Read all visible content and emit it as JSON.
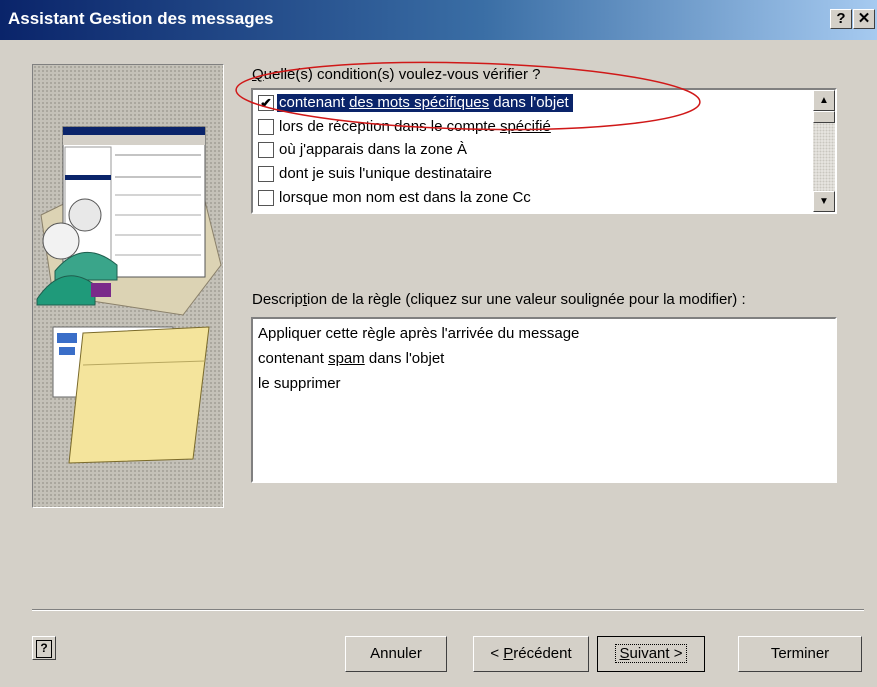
{
  "window": {
    "title": "Assistant Gestion des messages",
    "help_glyph": "?",
    "close_glyph": "✕"
  },
  "conditions": {
    "label_first": "Q",
    "label_rest": "uelle(s) condition(s) voulez-vous vérifier ?",
    "items": [
      {
        "pre": "contenant ",
        "link": "des mots spécifiques",
        "post": " dans l'objet",
        "checked": true,
        "selected": true
      },
      {
        "pre": "lors de réception dans le compte ",
        "link": "spécifié",
        "post": "",
        "checked": false,
        "selected": false
      },
      {
        "pre": "où j'apparais dans la zone À",
        "link": "",
        "post": "",
        "checked": false,
        "selected": false
      },
      {
        "pre": "dont je suis l'unique destinataire",
        "link": "",
        "post": "",
        "checked": false,
        "selected": false
      },
      {
        "pre": "lorsque mon nom est dans la zone Cc",
        "link": "",
        "post": "",
        "checked": false,
        "selected": false
      }
    ],
    "check_glyph": "✔"
  },
  "description": {
    "label_pre": "Descrip",
    "label_u": "t",
    "label_post": "ion de la règle (cliquez sur une valeur soulignée pour la modifier) :",
    "line1": "Appliquer cette règle après l'arrivée du message",
    "line2_pre": "contenant ",
    "line2_link": "spam",
    "line2_post": " dans l'objet",
    "line3": "le supprimer"
  },
  "buttons": {
    "cancel": "Annuler",
    "prev_pre": "< ",
    "prev_u": "P",
    "prev_post": "récédent",
    "next_u": "S",
    "next_post": "uivant >",
    "finish": "Terminer",
    "help_glyph": "?"
  },
  "colors": {
    "selection": "#0a246a",
    "annotation": "#d01818"
  }
}
